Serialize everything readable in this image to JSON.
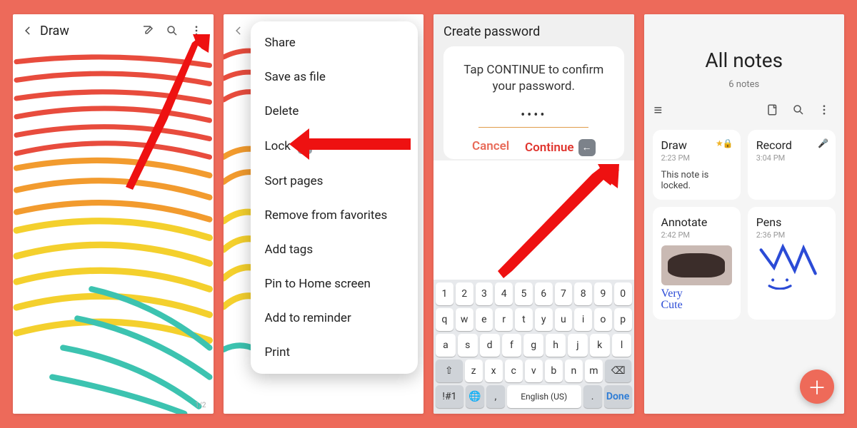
{
  "panel1": {
    "title": "Draw",
    "page_indicator": "1/2"
  },
  "panel2": {
    "menu": [
      "Share",
      "Save as file",
      "Delete",
      "Lock",
      "Sort pages",
      "Remove from favorites",
      "Add tags",
      "Pin to Home screen",
      "Add to reminder",
      "Print"
    ]
  },
  "panel3": {
    "title": "Create password",
    "message_line1": "Tap CONTINUE to confirm",
    "message_line2": "your password.",
    "dots": "••••",
    "cancel": "Cancel",
    "continue": "Continue",
    "keyboard": {
      "row_num": [
        "1",
        "2",
        "3",
        "4",
        "5",
        "6",
        "7",
        "8",
        "9",
        "0"
      ],
      "row_q": [
        "q",
        "w",
        "e",
        "r",
        "t",
        "y",
        "u",
        "i",
        "o",
        "p"
      ],
      "row_a": [
        "a",
        "s",
        "d",
        "f",
        "g",
        "h",
        "j",
        "k",
        "l"
      ],
      "row_z": [
        "z",
        "x",
        "c",
        "v",
        "b",
        "n",
        "m"
      ],
      "shift": "⇧",
      "bksp": "⌫",
      "sym": "!#1",
      "lang": "English (US)",
      "done": "Done",
      "comma": ",",
      "period": "."
    }
  },
  "panel4": {
    "heading": "All notes",
    "subtitle": "6 notes",
    "cards": {
      "draw": {
        "title": "Draw",
        "time": "2:23 PM",
        "body": "This note is locked."
      },
      "record": {
        "title": "Record",
        "time": "3:04 PM"
      },
      "annotate": {
        "title": "Annotate",
        "time": "2:42 PM",
        "hand1": "Very",
        "hand2": "Cute"
      },
      "pens": {
        "title": "Pens",
        "time": "2:36 PM"
      }
    }
  }
}
